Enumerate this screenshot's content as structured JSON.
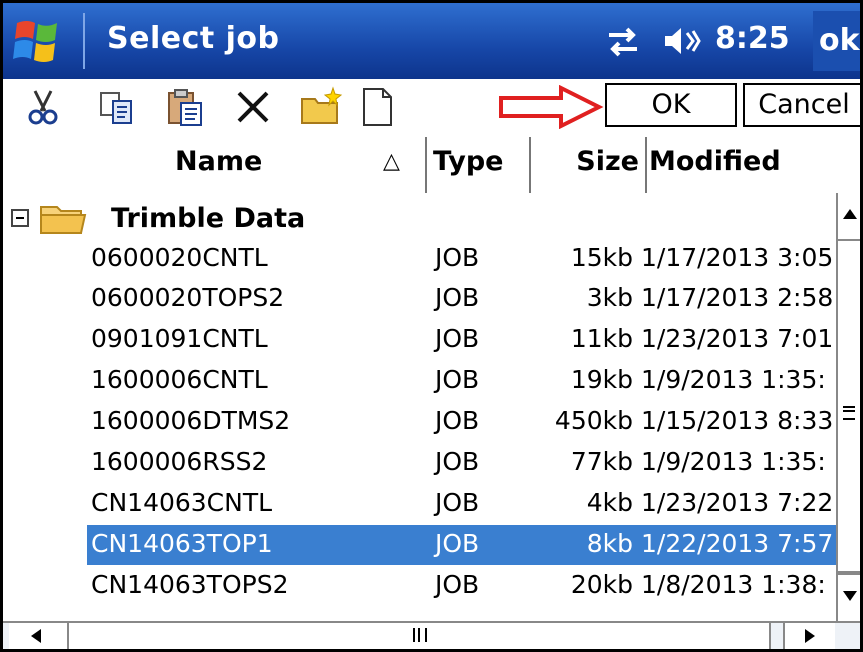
{
  "titlebar": {
    "title": "Select job",
    "time": "8:25",
    "ok_label": "ok",
    "start_icon": "windows-flag-icon",
    "connectivity_icon": "connectivity-icon",
    "volume_icon": "speaker-icon"
  },
  "toolbar": {
    "icons": [
      "cut-icon",
      "copy-icon",
      "paste-icon",
      "delete-icon",
      "new-folder-icon",
      "new-file-icon"
    ],
    "ok_label": "OK",
    "cancel_label": "Cancel",
    "annotation_color": "#e02020"
  },
  "columns": {
    "name": "Name",
    "sort_indicator": "△",
    "type": "Type",
    "size": "Size",
    "modified": "Modified"
  },
  "folder": {
    "label": "Trimble Data"
  },
  "files": [
    {
      "name": "0600020CNTL",
      "type": "JOB",
      "size": "15kb",
      "modified": "1/17/2013 3:05"
    },
    {
      "name": "0600020TOPS2",
      "type": "JOB",
      "size": "3kb",
      "modified": "1/17/2013 2:58"
    },
    {
      "name": "0901091CNTL",
      "type": "JOB",
      "size": "11kb",
      "modified": "1/23/2013 7:01"
    },
    {
      "name": "1600006CNTL",
      "type": "JOB",
      "size": "19kb",
      "modified": "1/9/2013 1:35:"
    },
    {
      "name": "1600006DTMS2",
      "type": "JOB",
      "size": "450kb",
      "modified": "1/15/2013 8:33"
    },
    {
      "name": "1600006RSS2",
      "type": "JOB",
      "size": "77kb",
      "modified": "1/9/2013 1:35:"
    },
    {
      "name": "CN14063CNTL",
      "type": "JOB",
      "size": "4kb",
      "modified": "1/23/2013 7:22"
    },
    {
      "name": "CN14063TOP1",
      "type": "JOB",
      "size": "8kb",
      "modified": "1/22/2013 7:57"
    },
    {
      "name": "CN14063TOPS2",
      "type": "JOB",
      "size": "20kb",
      "modified": "1/8/2013 1:38:"
    }
  ],
  "selected_index": 7,
  "colors": {
    "titlebar": "#1747a8",
    "selection": "#3a7fd0"
  }
}
